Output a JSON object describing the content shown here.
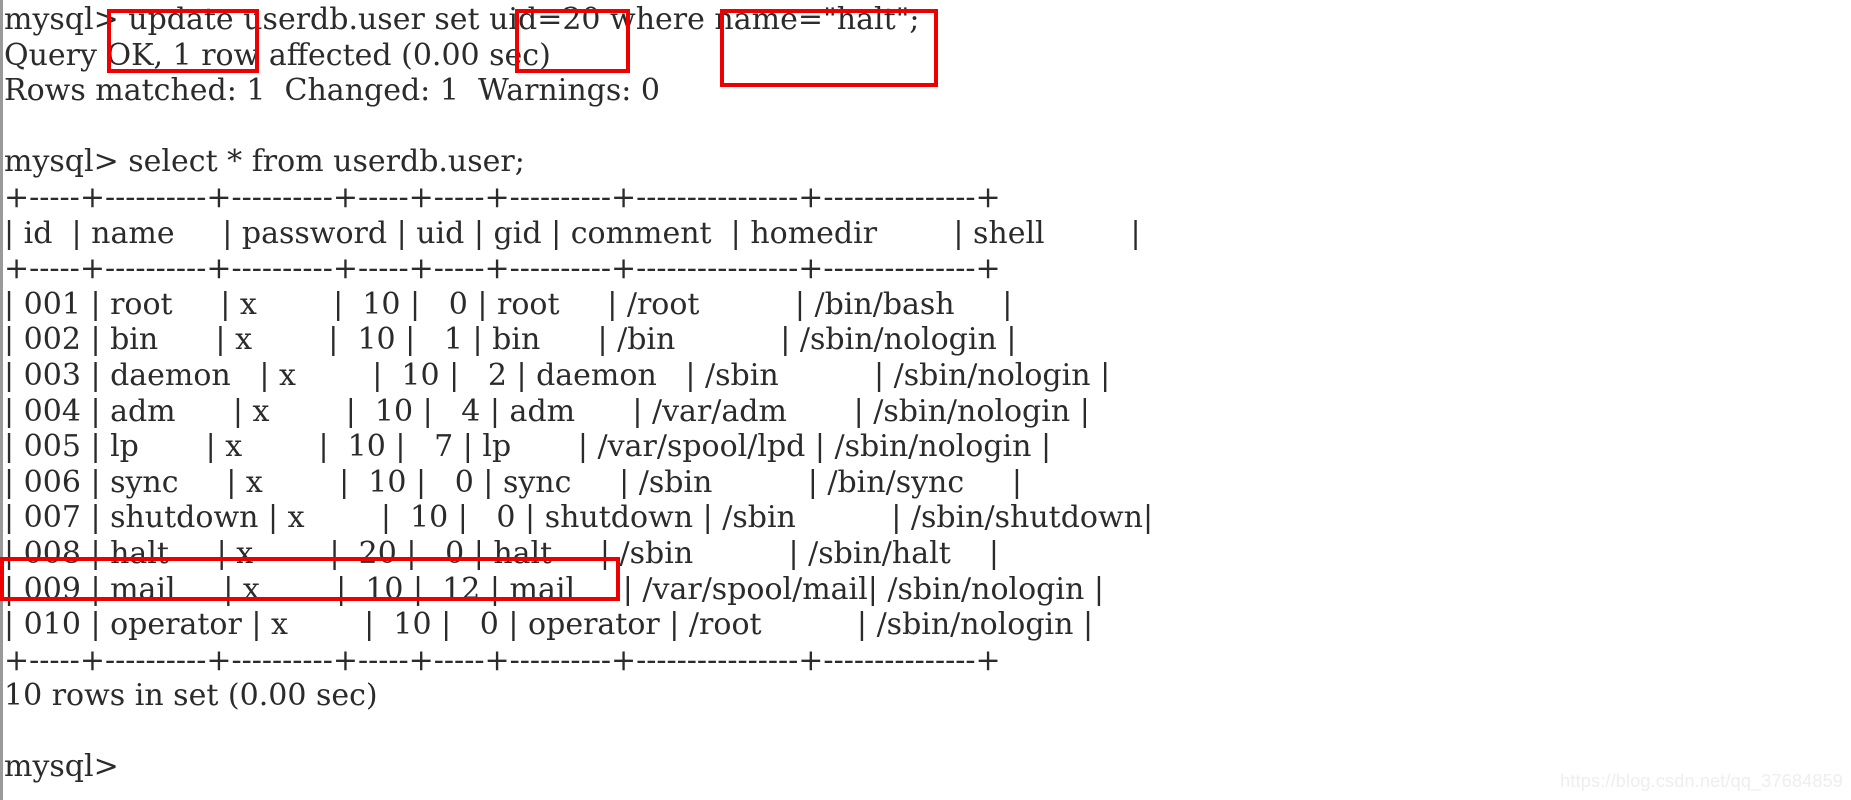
{
  "window": {
    "title": "MySQL terminal session",
    "background": "#ffffff",
    "foreground": "#2b2b2b",
    "annotation_color": "#ee0000"
  },
  "terminal": {
    "prompt": "mysql>",
    "lines": [
      "mysql> update userdb.user set uid=20 where name=\"halt\";",
      "Query OK, 1 row affected (0.00 sec)",
      "Rows matched: 1  Changed: 1  Warnings: 0",
      "",
      "mysql> select * from userdb.user;",
      "+-----+----------+----------+-----+-----+----------+----------------+---------------+",
      "| id  | name     | password | uid | gid | comment  | homedir        | shell         |",
      "+-----+----------+----------+-----+-----+----------+----------------+---------------+",
      "| 001 | root     | x        |  10 |   0 | root     | /root          | /bin/bash     |",
      "| 002 | bin      | x        |  10 |   1 | bin      | /bin           | /sbin/nologin |",
      "| 003 | daemon   | x        |  10 |   2 | daemon   | /sbin          | /sbin/nologin |",
      "| 004 | adm      | x        |  10 |   4 | adm      | /var/adm       | /sbin/nologin |",
      "| 005 | lp       | x        |  10 |   7 | lp       | /var/spool/lpd | /sbin/nologin |",
      "| 006 | sync     | x        |  10 |   0 | sync     | /sbin          | /bin/sync     |",
      "| 007 | shutdown | x        |  10 |   0 | shutdown | /sbin          | /sbin/shutdown|",
      "| 008 | halt     | x        |  20 |   0 | halt     | /sbin          | /sbin/halt    |",
      "| 009 | mail     | x        |  10 |  12 | mail     | /var/spool/mail| /sbin/nologin |",
      "| 010 | operator | x        |  10 |   0 | operator | /root          | /sbin/nologin |",
      "+-----+----------+----------+-----+-----+----------+----------------+---------------+",
      "10 rows in set (0.00 sec)",
      "",
      "mysql>"
    ]
  },
  "command": {
    "full": "mysql> update userdb.user set uid=20 where name=\"halt\";",
    "keyword": "update",
    "set_clause": "uid=20",
    "where_clause": "name=\"halt\";",
    "table": "userdb.user"
  },
  "result_messages": {
    "status": "Query OK, 1 row affected (0.00 sec)",
    "detail": "Rows matched: 1  Changed: 1  Warnings: 0",
    "rows_in_set": "10 rows in set (0.00 sec)"
  },
  "select_query": "mysql> select * from userdb.user;",
  "table": {
    "columns": [
      "id",
      "name",
      "password",
      "uid",
      "gid",
      "comment",
      "homedir",
      "shell"
    ],
    "rows": [
      {
        "id": "001",
        "name": "root",
        "password": "x",
        "uid": "10",
        "gid": "0",
        "comment": "root",
        "homedir": "/root",
        "shell": "/bin/bash"
      },
      {
        "id": "002",
        "name": "bin",
        "password": "x",
        "uid": "10",
        "gid": "1",
        "comment": "bin",
        "homedir": "/bin",
        "shell": "/sbin/nologin"
      },
      {
        "id": "003",
        "name": "daemon",
        "password": "x",
        "uid": "10",
        "gid": "2",
        "comment": "daemon",
        "homedir": "/sbin",
        "shell": "/sbin/nologin"
      },
      {
        "id": "004",
        "name": "adm",
        "password": "x",
        "uid": "10",
        "gid": "4",
        "comment": "adm",
        "homedir": "/var/adm",
        "shell": "/sbin/nologin"
      },
      {
        "id": "005",
        "name": "lp",
        "password": "x",
        "uid": "10",
        "gid": "7",
        "comment": "lp",
        "homedir": "/var/spool/lpd",
        "shell": "/sbin/nologin"
      },
      {
        "id": "006",
        "name": "sync",
        "password": "x",
        "uid": "10",
        "gid": "0",
        "comment": "sync",
        "homedir": "/sbin",
        "shell": "/bin/sync"
      },
      {
        "id": "007",
        "name": "shutdown",
        "password": "x",
        "uid": "10",
        "gid": "0",
        "comment": "shutdown",
        "homedir": "/sbin",
        "shell": "/sbin/shutdown"
      },
      {
        "id": "008",
        "name": "halt",
        "password": "x",
        "uid": "20",
        "gid": "0",
        "comment": "halt",
        "homedir": "/sbin",
        "shell": "/sbin/halt"
      },
      {
        "id": "009",
        "name": "mail",
        "password": "x",
        "uid": "10",
        "gid": "12",
        "comment": "mail",
        "homedir": "/var/spool/mail",
        "shell": "/sbin/nologin"
      },
      {
        "id": "010",
        "name": "operator",
        "password": "x",
        "uid": "10",
        "gid": "0",
        "comment": "operator",
        "homedir": "/root",
        "shell": "/sbin/nologin"
      }
    ],
    "highlighted_row_id": "008",
    "row_count": 10
  },
  "annotations": [
    {
      "name": "update-keyword-highlight",
      "label": "update"
    },
    {
      "name": "uid-assignment-highlight",
      "label": "uid=20"
    },
    {
      "name": "where-clause-highlight",
      "label": "name=\"halt\";"
    },
    {
      "name": "halt-row-highlight",
      "label": "008 halt x 20"
    }
  ],
  "watermark": {
    "text": "https://blog.csdn.net/qq_37684859"
  }
}
